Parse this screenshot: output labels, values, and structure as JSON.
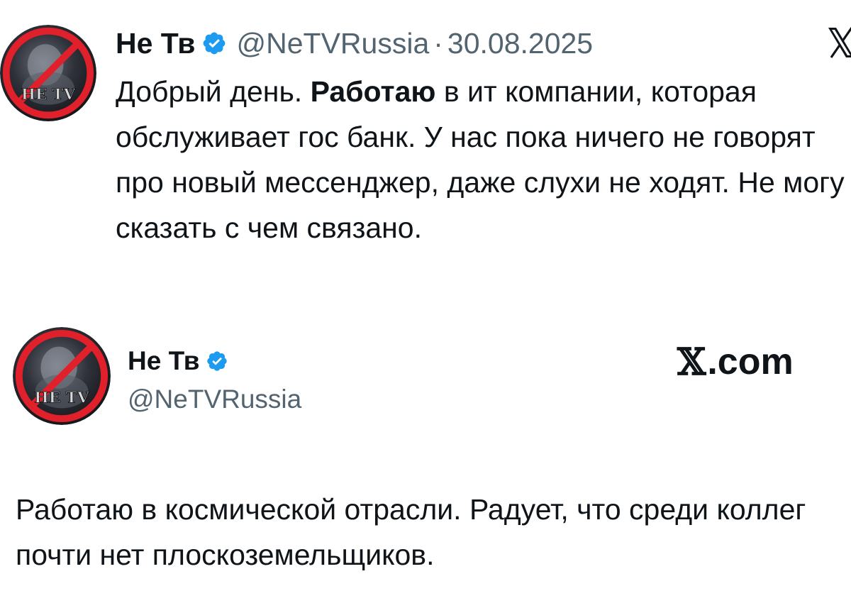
{
  "tweet1": {
    "author": {
      "name": "Не Тв",
      "handle": "@NeTVRussia",
      "avatar_text": "НЕ ТV",
      "verified_icon": "verified-badge-icon"
    },
    "separator": "·",
    "date": "30.08.2025",
    "text": {
      "part1": "Добрый день. ",
      "bold": "Работаю",
      "part2": " в ит компании, которая обслуживает гос банк. У нас пока ничего не говорят про новый мессенджер, даже слухи не ходят. Не могу сказать с чем связано."
    },
    "platform_icon": "x-logo-icon"
  },
  "tweet2": {
    "author": {
      "name": "Не Тв",
      "handle": "@NeTVRussia",
      "avatar_text": "НЕ ТV",
      "verified_icon": "verified-badge-icon"
    },
    "platform": {
      "mark": "𝕏",
      "domain": ".com"
    },
    "text": "Работаю в космической отрасли. Радует, что среди коллег почти нет плоскоземельщиков."
  },
  "colors": {
    "text": "#0f1419",
    "secondary": "#536471",
    "verified": "#1d9bf0",
    "avatar_ring": "#e0202a"
  }
}
